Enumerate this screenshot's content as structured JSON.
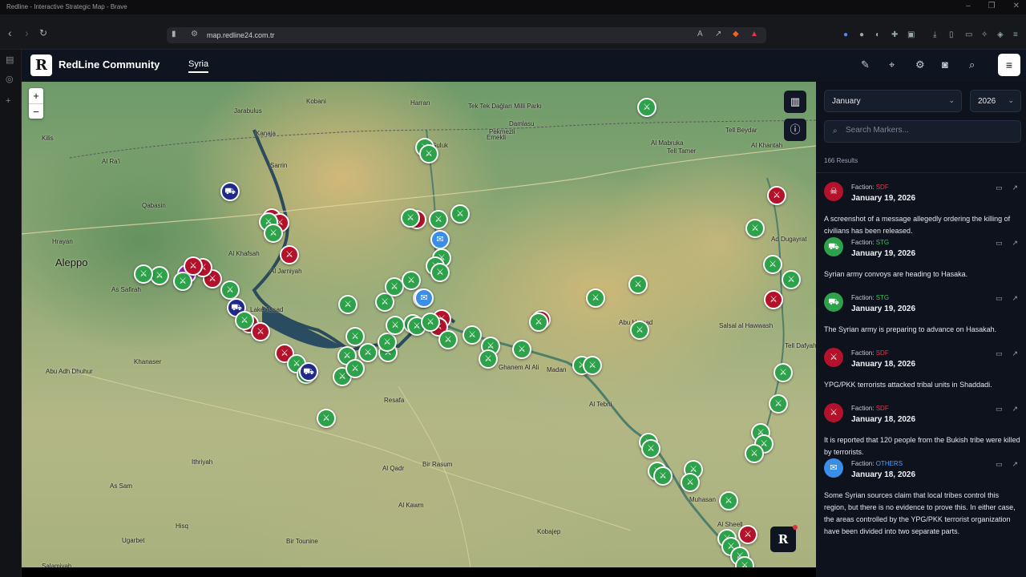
{
  "browser": {
    "window_title": "Redline - Interactive Strategic Map - Brave",
    "url": "map.redline24.com.tr"
  },
  "app": {
    "logo_letter": "R",
    "brand": "RedLine Community",
    "tab": "Syria"
  },
  "map": {
    "zoom_in": "+",
    "zoom_out": "−",
    "logo_letter": "R",
    "places": [
      {
        "name": "Kobani"
      },
      {
        "name": "Jarabulus"
      },
      {
        "name": "Harran"
      },
      {
        "name": "Tek Tek Dağları Milli Parkı"
      },
      {
        "name": "Damlasu"
      },
      {
        "name": "Pekmezli"
      },
      {
        "name": "Emekli"
      },
      {
        "name": "Suluk"
      },
      {
        "name": "Kilis"
      },
      {
        "name": "Al Ra'i"
      },
      {
        "name": "Kanaja"
      },
      {
        "name": "Sarrin"
      },
      {
        "name": "Al Mabruka"
      },
      {
        "name": "Tell Tamer"
      },
      {
        "name": "Tell Beydar"
      },
      {
        "name": "Al Khantah"
      },
      {
        "name": "Qabasin"
      },
      {
        "name": "Hrayan"
      },
      {
        "name": "Aleppo"
      },
      {
        "name": "Al Khafsah"
      },
      {
        "name": "Al Jarniyah"
      },
      {
        "name": "Ad Dugayrat"
      },
      {
        "name": "As Safirah"
      },
      {
        "name": "Lake Assad"
      },
      {
        "name": "Khanaser"
      },
      {
        "name": "Abu Adh Dhuhur"
      },
      {
        "name": "Resafa"
      },
      {
        "name": "Ghanem Al Ali"
      },
      {
        "name": "Madan"
      },
      {
        "name": "Abu Hamad"
      },
      {
        "name": "Salsal al Hawwash"
      },
      {
        "name": "Tell Dafyah"
      },
      {
        "name": "Al Tebni"
      },
      {
        "name": "Ithriyah"
      },
      {
        "name": "As Sam"
      },
      {
        "name": "Al Qadr"
      },
      {
        "name": "Bir Rasum"
      },
      {
        "name": "Al Kawm"
      },
      {
        "name": "Ugarbet"
      },
      {
        "name": "Hisq"
      },
      {
        "name": "Bir Tounine"
      },
      {
        "name": "Salamiyah"
      },
      {
        "name": "Kobajep"
      },
      {
        "name": "Muhasan"
      },
      {
        "name": "Al Sheell"
      }
    ]
  },
  "panel": {
    "month": "January",
    "year": "2026",
    "search_placeholder": "Search Markers...",
    "results": "166 Results",
    "faction_label": "Faction:",
    "items": [
      {
        "faction": "SDF",
        "faction_color": "#e0394b",
        "date": "January 19, 2026",
        "text": "A screenshot of a message allegedly ordering the killing of civilians has been released.",
        "icon": "skull-icon",
        "icon_bg": "#b3122a"
      },
      {
        "faction": "STG",
        "faction_color": "#3fbf5f",
        "date": "January 19, 2026",
        "text": "Syrian army convoys are heading to Hasaka.",
        "icon": "truck-icon",
        "icon_bg": "#2ea24a"
      },
      {
        "faction": "STG",
        "faction_color": "#3fbf5f",
        "date": "January 19, 2026",
        "text": "The Syrian army is preparing to advance on Hasakah.",
        "icon": "truck-icon",
        "icon_bg": "#2ea24a"
      },
      {
        "faction": "SDF",
        "faction_color": "#e0394b",
        "date": "January 18, 2026",
        "text": "YPG/PKK terrorists attacked tribal units in Shaddadi.",
        "icon": "rifle-icon",
        "icon_bg": "#b3122a"
      },
      {
        "faction": "SDF",
        "faction_color": "#e0394b",
        "date": "January 18, 2026",
        "text": "It is reported that 120 people from the Bukish tribe were killed by terrorists.",
        "icon": "rifle-icon",
        "icon_bg": "#b3122a"
      },
      {
        "faction": "OTHERS",
        "faction_color": "#4aa3ff",
        "date": "January 18, 2026",
        "text": "Some Syrian sources claim that local tribes control this region, but there is no evidence to prove this. In either case, the areas controlled by the YPG/PKK terrorist organization have been divided into two separate parts.",
        "icon": "megaphone-icon",
        "icon_bg": "#3a8ee8"
      }
    ]
  },
  "colors": {
    "sdf": "#b3122a",
    "stg": "#2ea24a",
    "others": "#3a8ee8",
    "navy": "#1f2a8a",
    "purple": "#8a2bb8"
  }
}
